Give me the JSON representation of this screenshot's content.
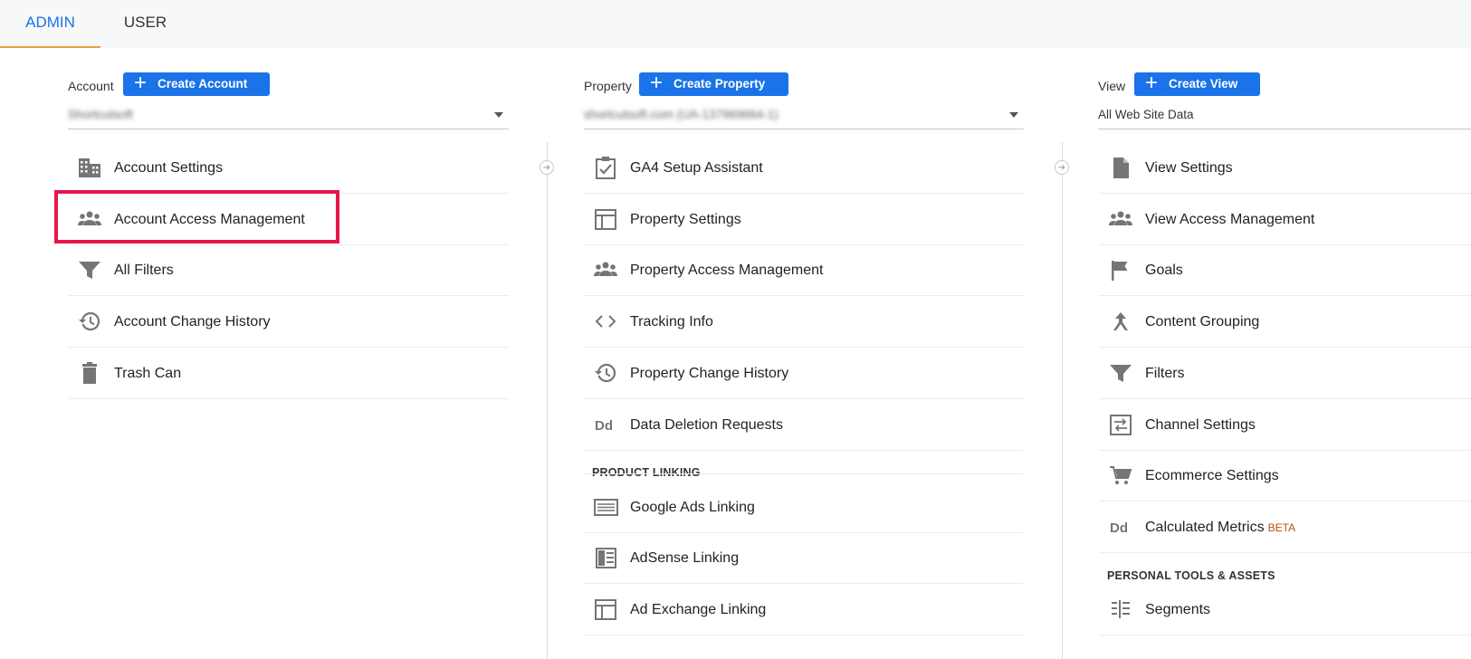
{
  "tabs": {
    "admin": "ADMIN",
    "user": "USER"
  },
  "account": {
    "label": "Account",
    "create_label": "Create Account",
    "selected": "Shortcutsoft",
    "items": [
      {
        "label": "Account Settings",
        "icon": "building-icon"
      },
      {
        "label": "Account Access Management",
        "icon": "people-icon"
      },
      {
        "label": "All Filters",
        "icon": "filter-icon"
      },
      {
        "label": "Account Change History",
        "icon": "history-icon"
      },
      {
        "label": "Trash Can",
        "icon": "trash-icon"
      }
    ]
  },
  "property": {
    "label": "Property",
    "create_label": "Create Property",
    "selected": "shortcutsoft.com (UA-137969664-1)",
    "items": [
      {
        "label": "GA4 Setup Assistant",
        "icon": "checklist-icon"
      },
      {
        "label": "Property Settings",
        "icon": "layout-icon"
      },
      {
        "label": "Property Access Management",
        "icon": "people-icon"
      },
      {
        "label": "Tracking Info",
        "icon": "code-icon"
      },
      {
        "label": "Property Change History",
        "icon": "history-icon"
      },
      {
        "label": "Data Deletion Requests",
        "icon": "dd-icon"
      }
    ],
    "section_title": "PRODUCT LINKING",
    "linking": [
      {
        "label": "Google Ads Linking",
        "icon": "ads-icon"
      },
      {
        "label": "AdSense Linking",
        "icon": "adsense-icon"
      },
      {
        "label": "Ad Exchange Linking",
        "icon": "layout-icon"
      }
    ]
  },
  "view": {
    "label": "View",
    "create_label": "Create View",
    "selected": "All Web Site Data",
    "items": [
      {
        "label": "View Settings",
        "icon": "document-icon"
      },
      {
        "label": "View Access Management",
        "icon": "people-icon"
      },
      {
        "label": "Goals",
        "icon": "flag-icon"
      },
      {
        "label": "Content Grouping",
        "icon": "merge-icon"
      },
      {
        "label": "Filters",
        "icon": "filter-icon"
      },
      {
        "label": "Channel Settings",
        "icon": "channel-icon"
      },
      {
        "label": "Ecommerce Settings",
        "icon": "cart-icon"
      },
      {
        "label": "Calculated Metrics",
        "icon": "dd-icon"
      }
    ],
    "beta_label": "BETA",
    "section_title": "PERSONAL TOOLS & ASSETS",
    "tools": [
      {
        "label": "Segments",
        "icon": "segments-icon"
      }
    ]
  },
  "colors": {
    "accent": "#1a73e8",
    "highlight": "#e8144b",
    "icon": "#757575",
    "tab_underline": "#e8a33d"
  }
}
